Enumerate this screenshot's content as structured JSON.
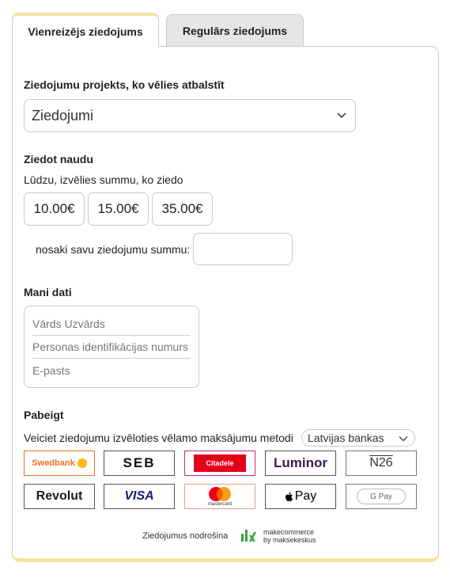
{
  "tabs": [
    {
      "label": "Vienreizējs ziedojums",
      "active": true
    },
    {
      "label": "Regulārs ziedojums",
      "active": false
    }
  ],
  "project": {
    "heading": "Ziedojumu projekts, ko vēlies atbalstīt",
    "selected": "Ziedojumi"
  },
  "amount": {
    "heading": "Ziedot naudu",
    "prompt": "Lūdzu, izvēlies summu, ko ziedo",
    "options": [
      "10.00€",
      "15.00€",
      "35.00€"
    ],
    "custom_label": "nosaki savu ziedojumu summu:",
    "custom_value": ""
  },
  "personal": {
    "heading": "Mani dati",
    "name_placeholder": "Vārds Uzvārds",
    "id_placeholder": "Personas identifikācijas numurs",
    "email_placeholder": "E-pasts"
  },
  "finish": {
    "heading": "Pabeigt",
    "instruction": "Veiciet ziedojumu izvēloties vēlamo maksājumu metodi",
    "country_select": "Latvijas bankas"
  },
  "payment_methods": [
    {
      "label": "Swedbank",
      "color": "#ee7023"
    },
    {
      "label": "SEB",
      "color": "#111111"
    },
    {
      "label": "Citadele",
      "color": "#e3001b"
    },
    {
      "label": "Luminor",
      "color": "#3b1a4f"
    },
    {
      "label": "N26",
      "color": "#333333"
    },
    {
      "label": "Revolut",
      "color": "#191c1f"
    },
    {
      "label": "VISA",
      "color": "#1a1f71"
    },
    {
      "label": "mastercard",
      "color": "#eb001b"
    },
    {
      "label": "Pay",
      "color": "#000000"
    },
    {
      "label": "G Pay",
      "color": "#5f6368"
    }
  ],
  "footer": {
    "secured_by": "Ziedojumus nodrošina",
    "brand_line1": "makecommerce",
    "brand_line2": "by maksekeskus"
  },
  "colors": {
    "accent_yellow": "#f2e3a3",
    "border": "#c9c9c9",
    "makecommerce_green": "#3aa54a"
  }
}
